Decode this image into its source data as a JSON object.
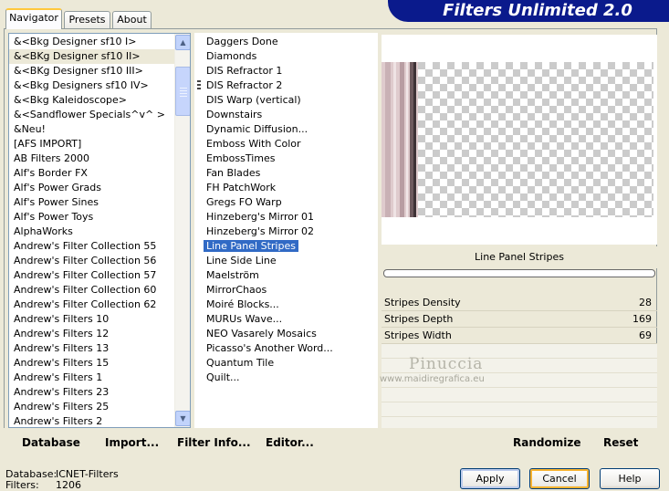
{
  "tabs": [
    {
      "label": "Navigator",
      "active": true
    },
    {
      "label": "Presets",
      "active": false
    },
    {
      "label": "About",
      "active": false
    }
  ],
  "banner": {
    "title": "Filters Unlimited 2.0"
  },
  "categories": {
    "items": [
      "&<Bkg Designer sf10 I>",
      "&<BKg Designer sf10 II>",
      "&<BKg Designer sf10 III>",
      "&<Bkg Designers sf10 IV>",
      "&<Bkg Kaleidoscope>",
      "&<Sandflower Specials^v^ >",
      "&Neu!",
      "[AFS IMPORT]",
      "AB Filters 2000",
      "Alf's Border FX",
      "Alf's Power Grads",
      "Alf's Power Sines",
      "Alf's Power Toys",
      "AlphaWorks",
      "Andrew's Filter Collection 55",
      "Andrew's Filter Collection 56",
      "Andrew's Filter Collection 57",
      "Andrew's Filter Collection 60",
      "Andrew's Filter Collection 62",
      "Andrew's Filters 10",
      "Andrew's Filters 12",
      "Andrew's Filters 13",
      "Andrew's Filters 15",
      "Andrew's Filters 1",
      "Andrew's Filters 23",
      "Andrew's Filters 25",
      "Andrew's Filters 2"
    ],
    "selected_index": 1
  },
  "filters": {
    "items": [
      "Daggers Done",
      "Diamonds",
      "DIS Refractor 1",
      "DIS Refractor 2",
      "DIS Warp (vertical)",
      "Downstairs",
      "Dynamic Diffusion...",
      "Emboss With Color",
      "EmbossTimes",
      "Fan Blades",
      "FH PatchWork",
      "Gregs FO Warp",
      "Hinzeberg's Mirror 01",
      "Hinzeberg's Mirror 02",
      "Line Panel Stripes",
      "Line Side Line",
      "Maelström",
      "MirrorChaos",
      "Moiré Blocks...",
      "MURUs Wave...",
      "NEO Vasarely Mosaics",
      "Picasso's Another Word...",
      "Quantum Tile",
      "Quilt..."
    ],
    "selected_index": 14
  },
  "preview": {
    "filter_name": "Line Panel Stripes",
    "progress": 0
  },
  "params": [
    {
      "label": "Stripes Density",
      "value": "28"
    },
    {
      "label": "Stripes Depth",
      "value": "169"
    },
    {
      "label": "Stripes Width",
      "value": "69"
    }
  ],
  "watermark": {
    "name": "Pinuccia",
    "site": "www.maidiregrafica.eu"
  },
  "toolbar": {
    "database": "Database",
    "import": "Import...",
    "filter_info": "Filter Info...",
    "editor": "Editor...",
    "randomize": "Randomize",
    "reset": "Reset"
  },
  "status": {
    "database_label": "Database:",
    "database_value": "ICNET-Filters",
    "filters_label": "Filters:",
    "filters_value": "1206"
  },
  "buttons": {
    "apply": "Apply",
    "cancel": "Cancel",
    "help": "Help"
  },
  "colors": {
    "selection": "#316ac5",
    "banner": "#0a1a8c",
    "stripe_pink": "#d8c0c4"
  }
}
